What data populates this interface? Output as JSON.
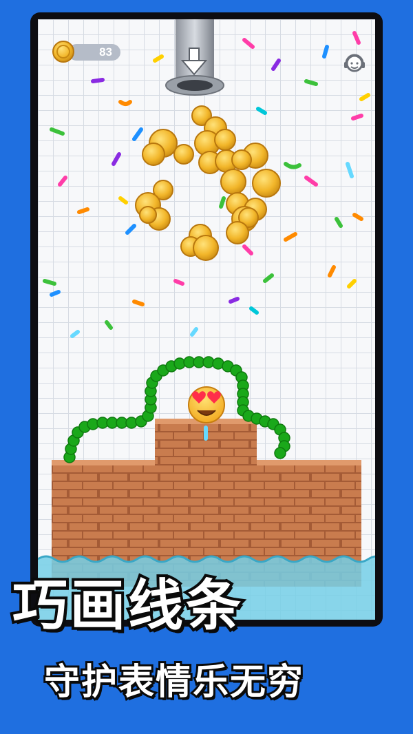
{
  "hud": {
    "coin_count": "83",
    "coin_icon": "coin-icon",
    "help_icon": "headset-support-icon"
  },
  "scene": {
    "pipe_icon": "arrow-down-icon",
    "emoji": "heart-eyes-emoji",
    "colors": {
      "wall": "#c77a4c",
      "mortar": "#a95e38",
      "line": "#1aa81a",
      "water": "#7fd3e8",
      "coin": "#f0b429"
    }
  },
  "promo": {
    "headline": "巧画线条",
    "subline": "守护表情乐无穷"
  }
}
